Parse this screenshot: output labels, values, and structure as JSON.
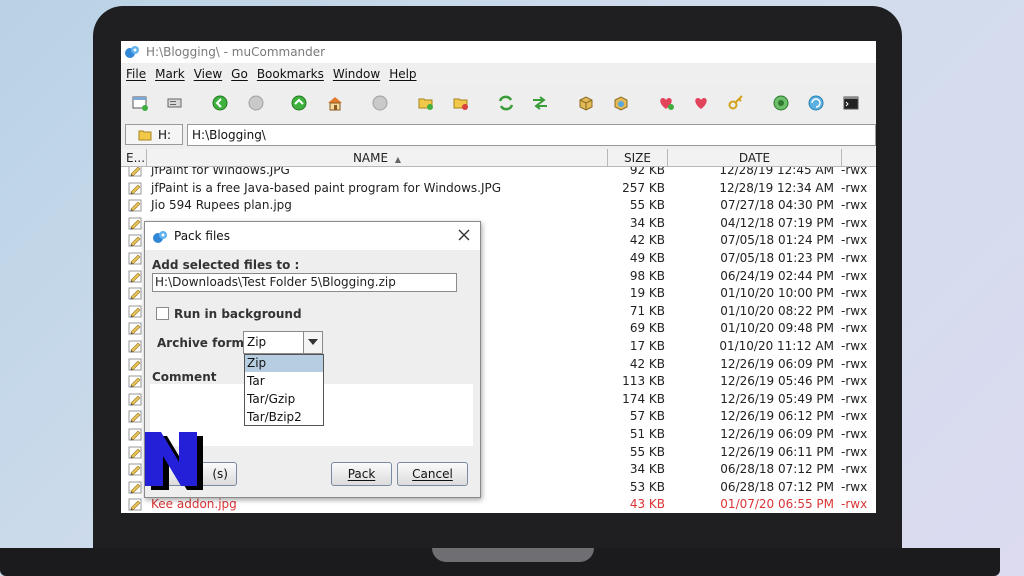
{
  "window": {
    "title": "H:\\Blogging\\ - muCommander"
  },
  "menubar": [
    {
      "label": "File"
    },
    {
      "label": "Mark"
    },
    {
      "label": "View"
    },
    {
      "label": "Go"
    },
    {
      "label": "Bookmarks"
    },
    {
      "label": "Window"
    },
    {
      "label": "Help"
    }
  ],
  "toolbar": {
    "icons": [
      "new-window-icon",
      "connect-server-icon",
      "go-back-icon",
      "go-forward-icon",
      "go-to-parent-icon",
      "home-icon",
      "stop-icon",
      "mark-files-icon",
      "unmark-files-icon",
      "swap-folders-icon",
      "set-same-folder-icon",
      "pack-files-icon",
      "unpack-files-icon",
      "add-bookmark-icon",
      "edit-bookmarks-icon",
      "edit-credentials-icon",
      "show-file-properties-icon",
      "refresh-icon",
      "terminal-icon"
    ]
  },
  "location": {
    "drive": "H:",
    "path": "H:\\Blogging\\"
  },
  "table": {
    "headers": {
      "ext": "E...",
      "name": "NAME",
      "size": "SIZE",
      "date": "DATE"
    },
    "rows": [
      {
        "name": "jfPaint for Windows.JPG",
        "size": "92 KB",
        "date": "12/28/19 12:45 AM",
        "perms": "-rwx",
        "color": ""
      },
      {
        "name": "jfPaint is a free Java-based paint program for Windows.JPG",
        "size": "257 KB",
        "date": "12/28/19 12:34 AM",
        "perms": "-rwx",
        "color": ""
      },
      {
        "name": "Jio 594 Rupees plan.jpg",
        "size": "55 KB",
        "date": "07/27/18 04:30 PM",
        "perms": "-rwx",
        "color": ""
      },
      {
        "name": "",
        "size": "34 KB",
        "date": "04/12/18 07:19 PM",
        "perms": "-rwx",
        "color": ""
      },
      {
        "name": "",
        "size": "42 KB",
        "date": "07/05/18 01:24 PM",
        "perms": "-rwx",
        "color": ""
      },
      {
        "name": "",
        "size": "49 KB",
        "date": "07/05/18 01:23 PM",
        "perms": "-rwx",
        "color": ""
      },
      {
        "name": "",
        "size": "98 KB",
        "date": "06/24/19 02:44 PM",
        "perms": "-rwx",
        "color": ""
      },
      {
        "name": "",
        "size": "19 KB",
        "date": "01/10/20 10:00 PM",
        "perms": "-rwx",
        "color": ""
      },
      {
        "name": "",
        "size": "71 KB",
        "date": "01/10/20 08:22 PM",
        "perms": "-rwx",
        "color": ""
      },
      {
        "name": "",
        "size": "69 KB",
        "date": "01/10/20 09:48 PM",
        "perms": "-rwx",
        "color": ""
      },
      {
        "name": "",
        "size": "17 KB",
        "date": "01/10/20 11:12 AM",
        "perms": "-rwx",
        "color": ""
      },
      {
        "name": "",
        "size": "42 KB",
        "date": "12/26/19 06:09 PM",
        "perms": "-rwx",
        "color": ""
      },
      {
        "name": "",
        "size": "113 KB",
        "date": "12/26/19 05:46 PM",
        "perms": "-rwx",
        "color": ""
      },
      {
        "name": "",
        "size": "174 KB",
        "date": "12/26/19 05:49 PM",
        "perms": "-rwx",
        "color": ""
      },
      {
        "name": "nd edit them.JPG",
        "size": "57 KB",
        "date": "12/26/19 06:12 PM",
        "perms": "-rwx",
        "color": ""
      },
      {
        "name": "",
        "size": "51 KB",
        "date": "12/26/19 06:09 PM",
        "perms": "-rwx",
        "color": ""
      },
      {
        "name": "",
        "size": "55 KB",
        "date": "12/26/19 06:11 PM",
        "perms": "-rwx",
        "color": ""
      },
      {
        "name": "",
        "size": "34 KB",
        "date": "06/28/18 07:12 PM",
        "perms": "-rwx",
        "color": ""
      },
      {
        "name": "",
        "size": "53 KB",
        "date": "06/28/18 07:12 PM",
        "perms": "-rwx",
        "color": ""
      },
      {
        "name": "Kee addon.jpg",
        "size": "43 KB",
        "date": "01/07/20 06:55 PM",
        "perms": "-rwx",
        "color": "#d93535"
      }
    ]
  },
  "dialog": {
    "title": "Pack files",
    "dest_label": "Add selected files to :",
    "dest_path": "H:\\Downloads\\Test Folder 5\\Blogging.zip",
    "run_background_label": "Run in background",
    "run_background_checked": false,
    "format_label": "Archive format",
    "format_selected": "Zip",
    "format_options": [
      "Zip",
      "Tar",
      "Tar/Gzip",
      "Tar/Bzip2"
    ],
    "comment_label": "Comment",
    "comment_value": "",
    "left_button_tail": "(s)",
    "pack_button": "Pack",
    "cancel_button": "Cancel"
  },
  "overlay": {
    "logo_letter": "N",
    "logo_color": "#2320d8"
  },
  "colors": {
    "selected_option": "#b7cde1",
    "error_text": "#d93535"
  }
}
